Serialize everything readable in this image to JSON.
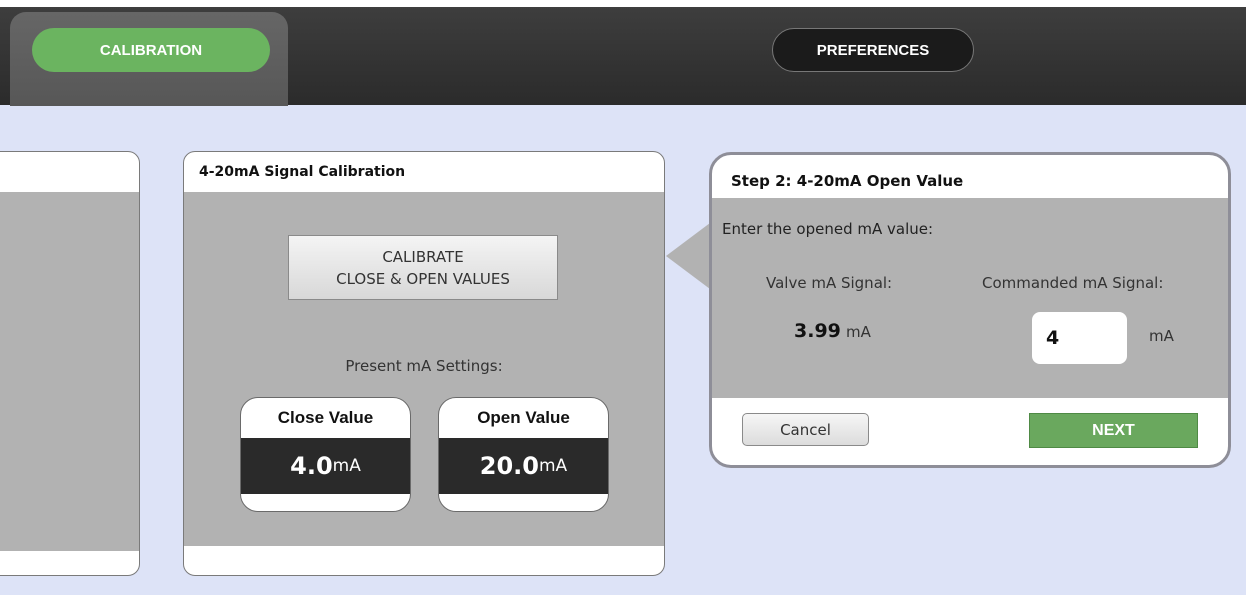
{
  "tabs": {
    "calibration": "CALIBRATION",
    "preferences": "PREFERENCES"
  },
  "calibration_panel": {
    "title": "4-20mA Signal Calibration",
    "calibrate_button": {
      "line1": "CALIBRATE",
      "line2": "CLOSE & OPEN VALUES"
    },
    "present_label": "Present mA Settings:",
    "close_value": {
      "header": "Close Value",
      "value": "4.0",
      "unit": "mA"
    },
    "open_value": {
      "header": "Open Value",
      "value": "20.0",
      "unit": "mA"
    }
  },
  "step_dialog": {
    "title": "Step 2: 4-20mA Open Value",
    "prompt": "Enter the opened mA value:",
    "valve_label": "Valve mA Signal:",
    "valve_value": "3.99",
    "valve_unit": "mA",
    "commanded_label": "Commanded mA Signal:",
    "commanded_value": "4",
    "commanded_unit": "mA",
    "cancel_label": "Cancel",
    "next_label": "NEXT"
  },
  "colors": {
    "accent_green": "#6bb460",
    "topbar": "#333333",
    "background": "#dde3f7",
    "panel_gray": "#b2b2b2"
  }
}
